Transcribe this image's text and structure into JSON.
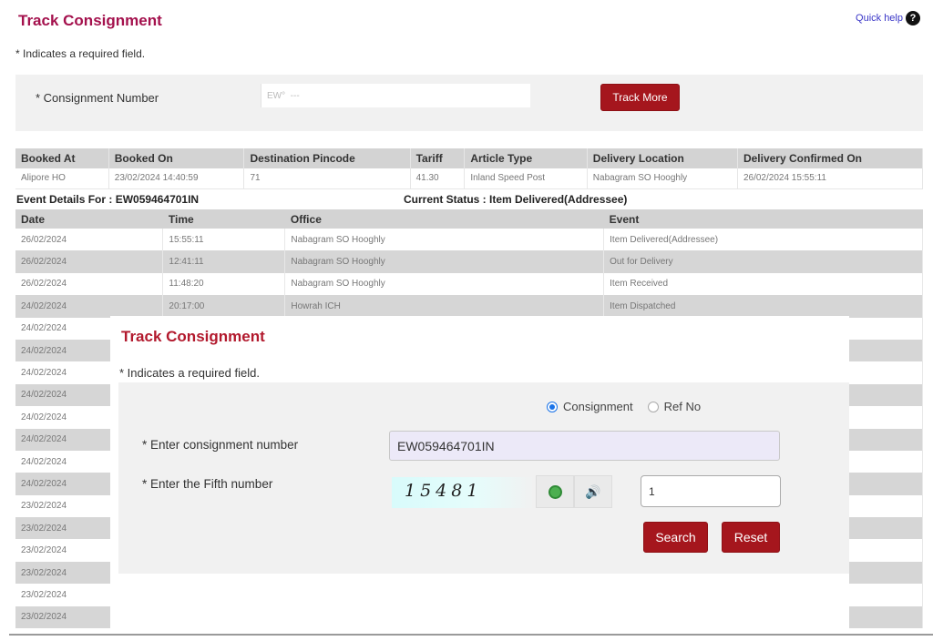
{
  "page": {
    "title": "Track Consignment",
    "quick_help": "Quick help",
    "help_icon": "?",
    "required_note": "* Indicates a required field."
  },
  "search_bar": {
    "label": "* Consignment Number",
    "input_value": "EW°  ---",
    "track_more_label": "Track More"
  },
  "booking": {
    "headers": [
      "Booked At",
      "Booked On",
      "Destination Pincode",
      "Tariff",
      "Article Type",
      "Delivery Location",
      "Delivery Confirmed On"
    ],
    "row": [
      "Alipore HO",
      "23/02/2024 14:40:59",
      "71",
      "41.30",
      "Inland Speed Post",
      "Nabagram SO Hooghly",
      "26/02/2024 15:55:11"
    ]
  },
  "events": {
    "title": "Event Details For : EW059464701IN",
    "current_status": "Current Status : Item Delivered(Addressee)",
    "headers": [
      "Date",
      "Time",
      "Office",
      "Event"
    ],
    "rows": [
      [
        "26/02/2024",
        "15:55:11",
        "Nabagram SO Hooghly",
        "Item Delivered(Addressee)"
      ],
      [
        "26/02/2024",
        "12:41:11",
        "Nabagram SO Hooghly",
        "Out for Delivery"
      ],
      [
        "26/02/2024",
        "11:48:20",
        "Nabagram SO Hooghly",
        "Item Received"
      ],
      [
        "24/02/2024",
        "20:17:00",
        "Howrah ICH",
        "Item Dispatched"
      ],
      [
        "24/02/2024",
        "",
        "",
        ""
      ],
      [
        "24/02/2024",
        "",
        "",
        ""
      ],
      [
        "24/02/2024",
        "",
        "",
        ""
      ],
      [
        "24/02/2024",
        "",
        "",
        ""
      ],
      [
        "24/02/2024",
        "",
        "",
        ""
      ],
      [
        "24/02/2024",
        "",
        "",
        ""
      ],
      [
        "24/02/2024",
        "",
        "",
        ""
      ],
      [
        "24/02/2024",
        "",
        "",
        ""
      ],
      [
        "23/02/2024",
        "",
        "",
        ""
      ],
      [
        "23/02/2024",
        "",
        "",
        ""
      ],
      [
        "23/02/2024",
        "",
        "",
        ""
      ],
      [
        "23/02/2024",
        "",
        "",
        ""
      ],
      [
        "23/02/2024",
        "",
        "",
        ""
      ],
      [
        "23/02/2024",
        "",
        "",
        ""
      ]
    ]
  },
  "modal": {
    "title": "Track Consignment",
    "required_note": "* Indicates a required field.",
    "radio_consignment": "Consignment",
    "radio_refno": "Ref No",
    "consignment_label": "* Enter consignment number",
    "consignment_value": "EW059464701IN",
    "fifth_label": "* Enter the Fifth number",
    "captcha_text": "15481",
    "fifth_value": "1",
    "search_label": "Search",
    "reset_label": "Reset",
    "speaker_glyph": "🔊"
  }
}
